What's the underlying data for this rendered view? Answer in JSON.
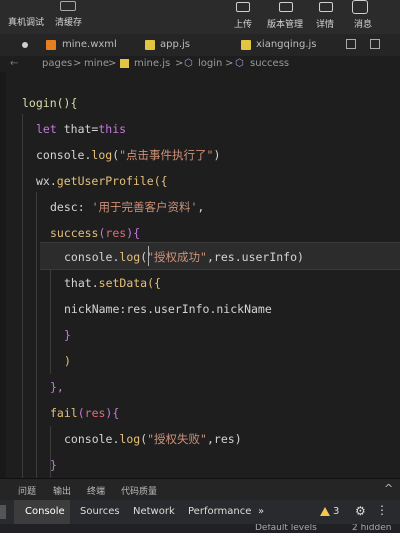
{
  "toolbar": {
    "left": [
      {
        "label": "真机调试"
      },
      {
        "label": "清缓存"
      }
    ],
    "right": [
      {
        "label": "上传"
      },
      {
        "label": "版本管理"
      },
      {
        "label": "详情"
      },
      {
        "label": "消息"
      }
    ]
  },
  "tabs": [
    {
      "label": "mine.wxml",
      "type": "wxml"
    },
    {
      "label": "app.js",
      "type": "js"
    },
    {
      "label": "xiangqing.js",
      "type": "js"
    }
  ],
  "breadcrumb": {
    "items": [
      "pages",
      "mine",
      "mine.js",
      "login",
      "success"
    ],
    "separator": ">"
  },
  "code": {
    "l1": [
      "login(){"
    ],
    "l2": [
      "let",
      "that",
      "=",
      "this"
    ],
    "l3": [
      "console",
      ".",
      "log",
      "(",
      "\"点击事件执行了\"",
      ")"
    ],
    "l4": [
      "wx",
      ".",
      "getUserProfile",
      "({"
    ],
    "l5": [
      "desc",
      ": ",
      "'用于完善客户资料'",
      ","
    ],
    "l6": [
      "success",
      "(",
      "res",
      "){"
    ],
    "l7": [
      "console",
      ".",
      "log",
      "(",
      "\"授权成功\"",
      ",",
      "res",
      ".",
      "userInfo",
      ")"
    ],
    "l8": [
      "that",
      ".",
      "setData",
      "({"
    ],
    "l9": [
      "nickName",
      ":",
      "res",
      ".",
      "userInfo",
      ".",
      "nickName"
    ],
    "l10": [
      "}"
    ],
    "l11": [
      ")"
    ],
    "l12": [
      "},"
    ],
    "l13": [
      "fail",
      "(",
      "res",
      "){"
    ],
    "l14": [
      "console",
      ".",
      "log",
      "(",
      "\"授权失败\"",
      ",",
      "res",
      ")"
    ],
    "l15": [
      "}"
    ]
  },
  "panel_tabs": [
    "问题",
    "输出",
    "终端",
    "代码质量"
  ],
  "devtools_tabs": [
    "Console",
    "Sources",
    "Network",
    "Performance",
    "»"
  ],
  "devtools_right": {
    "warnings": "3"
  },
  "filter_bar": {
    "levels": "Default levels",
    "hidden": "2 hidden"
  },
  "colors": {
    "keyword": "#c678dd",
    "string": "#ce9178",
    "function": "#e5c07b",
    "identifier": "#e06c75"
  }
}
